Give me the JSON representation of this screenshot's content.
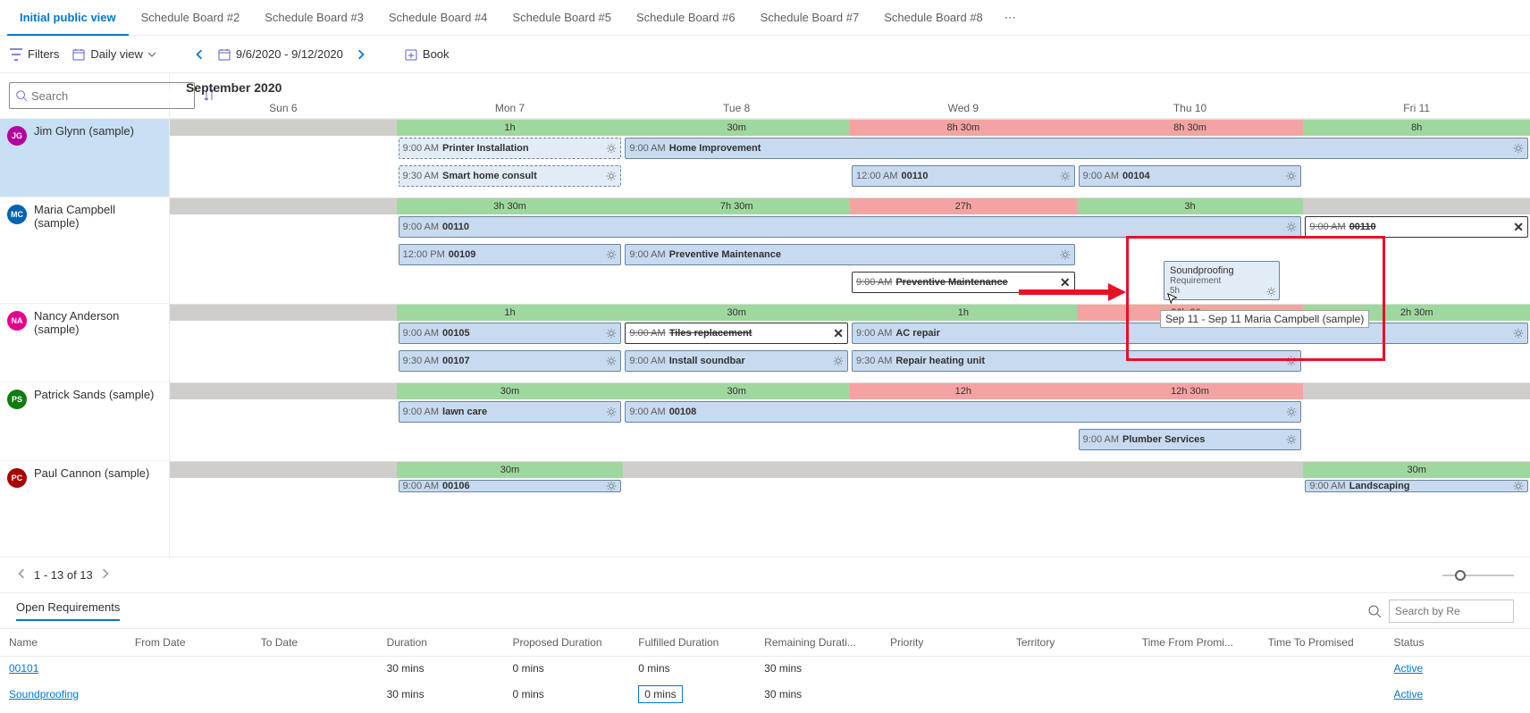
{
  "tabs": [
    "Initial public view",
    "Schedule Board #2",
    "Schedule Board #3",
    "Schedule Board #4",
    "Schedule Board #5",
    "Schedule Board #6",
    "Schedule Board #7",
    "Schedule Board #8"
  ],
  "toolbar": {
    "filters": "Filters",
    "view": "Daily view",
    "daterange": "9/6/2020 - 9/12/2020",
    "book": "Book"
  },
  "search": {
    "placeholder": "Search"
  },
  "month": "September 2020",
  "days": [
    "Sun 6",
    "Mon 7",
    "Tue 8",
    "Wed 9",
    "Thu 10",
    "Fri 11"
  ],
  "resources": [
    {
      "initials": "JG",
      "color": "#b4009e",
      "name": "Jim Glynn (sample)",
      "selected": true,
      "capacity": [
        {
          "c": "gray"
        },
        {
          "c": "green",
          "t": "1h"
        },
        {
          "c": "green",
          "t": "30m"
        },
        {
          "c": "red",
          "t": "8h 30m"
        },
        {
          "c": "red",
          "t": "8h 30m"
        },
        {
          "c": "green",
          "t": "8h"
        }
      ],
      "lanes": [
        [
          {
            "from": 1,
            "to": 2,
            "time": "9:00 AM",
            "title": "Printer Installation",
            "style": "dashed",
            "gear": true
          },
          {
            "from": 2,
            "to": 6,
            "time": "9:00 AM",
            "title": "Home Improvement",
            "gear": true
          }
        ],
        [
          {
            "from": 1,
            "to": 2,
            "time": "9:30 AM",
            "title": "Smart home consult",
            "style": "dashed",
            "gear": true
          },
          {
            "from": 3,
            "to": 4,
            "time": "12:00 AM",
            "title": "00110",
            "gear": true
          },
          {
            "from": 4,
            "to": 5,
            "time": "9:00 AM",
            "title": "00104",
            "gear": true
          }
        ]
      ]
    },
    {
      "initials": "MC",
      "color": "#0063b1",
      "name": "Maria Campbell (sample)",
      "capacity": [
        {
          "c": "gray"
        },
        {
          "c": "green",
          "t": "3h 30m"
        },
        {
          "c": "green",
          "t": "7h 30m"
        },
        {
          "c": "red",
          "t": "27h"
        },
        {
          "c": "green",
          "t": "3h"
        },
        {
          "c": "gray"
        }
      ],
      "lanes": [
        [
          {
            "from": 1,
            "to": 5,
            "time": "9:00 AM",
            "title": "00110",
            "gear": true
          },
          {
            "from": 5,
            "to": 6,
            "time": "9:00 AM",
            "title": "00110",
            "style": "white",
            "strike": true,
            "x": true
          }
        ],
        [
          {
            "from": 1,
            "to": 2,
            "time": "12:00 PM",
            "title": "00109",
            "gear": true
          },
          {
            "from": 2,
            "to": 4,
            "time": "9:00 AM",
            "title": "Preventive Maintenance",
            "gear": true
          }
        ],
        [
          {
            "from": 3,
            "to": 4,
            "time": "9:00 AM",
            "title": "Preventive Maintenance",
            "style": "white",
            "strike": true,
            "x": true
          }
        ]
      ]
    },
    {
      "initials": "NA",
      "color": "#e3008c",
      "name": "Nancy Anderson (sample)",
      "capacity": [
        {
          "c": "gray"
        },
        {
          "c": "green",
          "t": "1h"
        },
        {
          "c": "green",
          "t": "30m"
        },
        {
          "c": "green",
          "t": "1h"
        },
        {
          "c": "red",
          "t": "26h 30m"
        },
        {
          "c": "green",
          "t": "2h 30m"
        }
      ],
      "lanes": [
        [
          {
            "from": 1,
            "to": 2,
            "time": "9:00 AM",
            "title": "00105",
            "gear": true
          },
          {
            "from": 2,
            "to": 3,
            "time": "9:00 AM",
            "title": "Tiles replacement",
            "style": "white",
            "strike": true,
            "x": true
          },
          {
            "from": 3,
            "to": 6,
            "time": "9:00 AM",
            "title": "AC repair",
            "gear": true
          }
        ],
        [
          {
            "from": 1,
            "to": 2,
            "time": "9:30 AM",
            "title": "00107",
            "gear": true
          },
          {
            "from": 2,
            "to": 3,
            "time": "9:00 AM",
            "title": "Install soundbar",
            "gear": true
          },
          {
            "from": 3,
            "to": 5,
            "time": "9:30 AM",
            "title": "Repair heating unit",
            "gear": true
          }
        ]
      ]
    },
    {
      "initials": "PS",
      "color": "#107c10",
      "name": "Patrick Sands (sample)",
      "capacity": [
        {
          "c": "gray"
        },
        {
          "c": "green",
          "t": "30m"
        },
        {
          "c": "green",
          "t": "30m"
        },
        {
          "c": "red",
          "t": "12h"
        },
        {
          "c": "red",
          "t": "12h 30m"
        },
        {
          "c": "gray"
        }
      ],
      "lanes": [
        [
          {
            "from": 1,
            "to": 2,
            "time": "9:00 AM",
            "title": "lawn care",
            "gear": true
          },
          {
            "from": 2,
            "to": 5,
            "time": "9:00 AM",
            "title": "00108",
            "gear": true
          }
        ],
        [
          {
            "from": 4,
            "to": 5,
            "time": "9:00 AM",
            "title": "Plumber Services",
            "gear": true
          }
        ]
      ]
    },
    {
      "initials": "PC",
      "color": "#a80000",
      "name": "Paul Cannon (sample)",
      "capacity": [
        {
          "c": "gray"
        },
        {
          "c": "green",
          "t": "30m"
        },
        {
          "c": "gray"
        },
        {
          "c": "gray"
        },
        {
          "c": "gray"
        },
        {
          "c": "green",
          "t": "30m"
        }
      ],
      "lanes": [
        [
          {
            "from": 1,
            "to": 2,
            "time": "9:00 AM",
            "title": "00106",
            "gear": true,
            "clip": true
          },
          {
            "from": 5,
            "to": 6,
            "time": "9:00 AM",
            "title": "Landscaping",
            "gear": true,
            "clip": true
          }
        ]
      ]
    }
  ],
  "dragcard": {
    "title": "Soundproofing",
    "sub": "Requirement",
    "dur": "5h"
  },
  "tooltip": "Sep 11 - Sep 11 Maria Campbell (sample)",
  "pager": "1 - 13 of 13",
  "lower_tab": "Open Requirements",
  "lower_search_ph": "Search by Re",
  "cols": [
    "Name",
    "From Date",
    "To Date",
    "Duration",
    "Proposed Duration",
    "Fulfilled Duration",
    "Remaining Durati...",
    "Priority",
    "Territory",
    "Time From Promi...",
    "Time To Promised",
    "Status",
    ""
  ],
  "rows": [
    {
      "name": "00101",
      "dur": "30 mins",
      "pd": "0 mins",
      "fd": "0 mins",
      "rd": "30 mins",
      "status": "Active",
      "cut": true
    },
    {
      "name": "Soundproofing",
      "dur": "30 mins",
      "pd": "0 mins",
      "fd": "0 mins",
      "rd": "30 mins",
      "status": "Active",
      "fdsel": true
    }
  ]
}
